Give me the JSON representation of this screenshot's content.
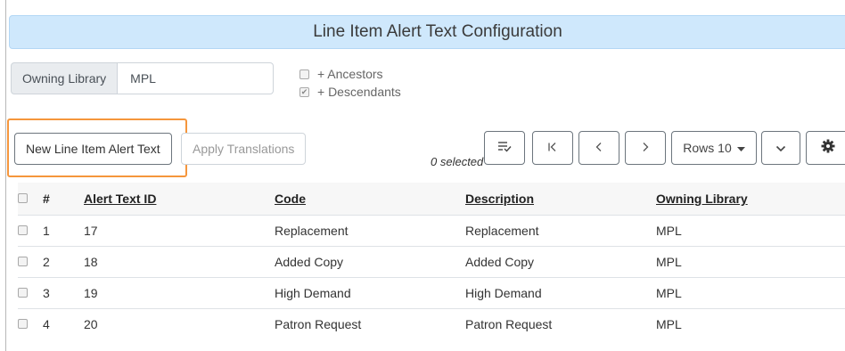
{
  "header": {
    "title": "Line Item Alert Text Configuration"
  },
  "filters": {
    "owning_library_label": "Owning Library",
    "owning_library_value": "MPL",
    "ancestors_label": "+ Ancestors",
    "ancestors_checked": false,
    "descendants_label": "+ Descendants",
    "descendants_checked": true
  },
  "toolbar": {
    "new_button": "New Line Item Alert Text",
    "apply_translations": "Apply Translations",
    "selected": "0 selected",
    "rows_button": "Rows 10",
    "icons": {
      "column_select": "lines-check-icon",
      "first_page": "first-page-icon",
      "prev_page": "chevron-left-icon",
      "next_page": "chevron-right-icon",
      "caret": "caret-down-icon",
      "expand": "chevron-down-icon",
      "settings": "gear-icon"
    }
  },
  "table": {
    "headers": {
      "index": "#",
      "alert_text_id": "Alert Text ID",
      "code": "Code",
      "description": "Description",
      "owning_library": "Owning Library"
    },
    "rows": [
      {
        "index": "1",
        "alert_text_id": "17",
        "code": "Replacement",
        "description": "Replacement",
        "owning_library": "MPL"
      },
      {
        "index": "2",
        "alert_text_id": "18",
        "code": "Added Copy",
        "description": "Added Copy",
        "owning_library": "MPL"
      },
      {
        "index": "3",
        "alert_text_id": "19",
        "code": "High Demand",
        "description": "High Demand",
        "owning_library": "MPL"
      },
      {
        "index": "4",
        "alert_text_id": "20",
        "code": "Patron Request",
        "description": "Patron Request",
        "owning_library": "MPL"
      }
    ]
  },
  "colors": {
    "title_bg": "#cfe8fc",
    "highlight": "#f5963c"
  }
}
